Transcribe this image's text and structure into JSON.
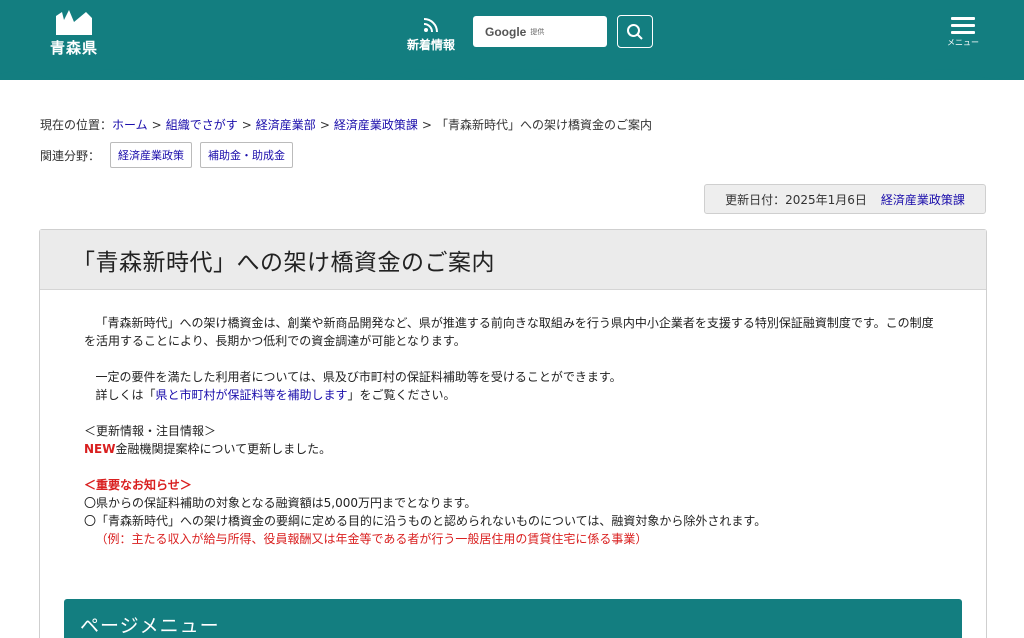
{
  "header": {
    "logo_text": "青森県",
    "news_label": "新着情報",
    "search_brand": "Google",
    "search_brand_sub": "提供",
    "menu_label": "メニュー",
    "brand_color": "#137e80"
  },
  "breadcrumb": {
    "prefix": "現在の位置：",
    "items": [
      "ホーム",
      "組織でさがす",
      "経済産業部",
      "経済産業政策課"
    ],
    "current": "「青森新時代」への架け橋資金のご案内",
    "separator": ">"
  },
  "related": {
    "label": "関連分野：",
    "tags": [
      "経済産業政策",
      "補助金・助成金"
    ]
  },
  "updated": {
    "text": "更新日付：2025年1月6日",
    "department": "経済産業政策課"
  },
  "article": {
    "title": "「青森新時代」への架け橋資金のご案内",
    "para1": "「青森新時代」への架け橋資金は、創業や新商品開発など、県が推進する前向きな取組みを行う県内中小企業者を支援する特別保証融資制度です。この制度を活用することにより、長期かつ低利での資金調達が可能となります。",
    "para2_line1": "一定の要件を満たした利用者については、県及び市町村の保証料補助等を受けることができます。",
    "para2_line2_pre": "詳しくは「",
    "para2_link": "県と市町村が保証料等を補助します",
    "para2_line2_post": "」をご覧ください。",
    "update_heading": "＜更新情報・注目情報＞",
    "new_badge": "NEW",
    "update_text": "金融機関提案枠について更新しました。",
    "important_heading": "＜重要なお知らせ＞",
    "notice1": "〇県からの保証料補助の対象となる融資額は5,000万円までとなります。",
    "notice2": "〇「青森新時代」への架け橋資金の要綱に定める目的に沿うものと認められないものについては、融資対象から除外されます。",
    "notice2_example": "（例：主たる収入が給与所得、役員報酬又は年金等である者が行う一般居住用の賃貸住宅に係る事業）"
  },
  "page_menu": {
    "title": "ページメニュー"
  }
}
